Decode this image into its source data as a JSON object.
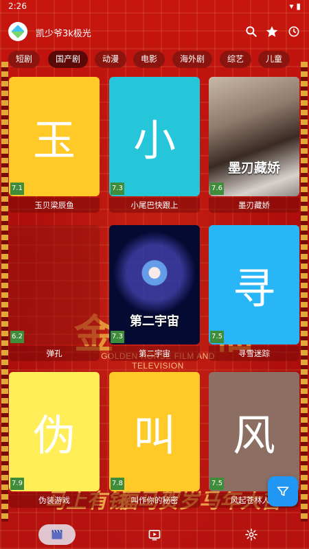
{
  "status": {
    "time": "2:26",
    "icons": "▾ ▮"
  },
  "app": {
    "title": "凯少爷3k极光"
  },
  "appbar_icons": [
    "search-icon",
    "star-icon",
    "history-icon"
  ],
  "tabs": [
    {
      "label": "短剧",
      "active": false
    },
    {
      "label": "国产剧",
      "active": true
    },
    {
      "label": "动漫",
      "active": false
    },
    {
      "label": "电影",
      "active": false
    },
    {
      "label": "海外剧",
      "active": false
    },
    {
      "label": "综艺",
      "active": false
    },
    {
      "label": "儿童",
      "active": false
    }
  ],
  "cards": [
    {
      "title": "玉贝梁辰鱼",
      "score": "7.1",
      "placeholder": "玉",
      "color": "#ffca28"
    },
    {
      "title": "小尾巴快跟上",
      "score": "7.3",
      "placeholder": "小",
      "color": "#26c6da"
    },
    {
      "title": "墨刃藏娇",
      "score": "7.6",
      "poster_text": "墨刃藏娇"
    },
    {
      "title": "弹孔",
      "score": "6.2"
    },
    {
      "title": "第二宇宙",
      "score": "7.3",
      "poster_text": "第二宇宙"
    },
    {
      "title": "寻雪迷踪",
      "score": "7.5",
      "placeholder": "寻",
      "color": "#29b6f6"
    },
    {
      "title": "伪装游戏",
      "score": "7.9",
      "placeholder": "伪",
      "color": "#ffee58"
    },
    {
      "title": "叫作你的秘密",
      "score": "7.8",
      "placeholder": "叫",
      "color": "#ffca28"
    },
    {
      "title": "风起苍林人生",
      "score": "7.5",
      "placeholder": "风",
      "color": "#8d6e63"
    }
  ],
  "background": {
    "banner_text": "GOLDEN HORSE FILM AND TELEVISION",
    "big_chars": [
      "金",
      "福"
    ],
    "bottom_texts": [
      "马上有钱",
      "福马贺岁",
      "马年大吉"
    ]
  },
  "bottomnav": [
    {
      "icon": "clapperboard-icon",
      "active": true
    },
    {
      "icon": "play-screen-icon",
      "active": false
    },
    {
      "icon": "settings-icon",
      "active": false
    }
  ],
  "fab": {
    "icon": "filter-icon"
  }
}
